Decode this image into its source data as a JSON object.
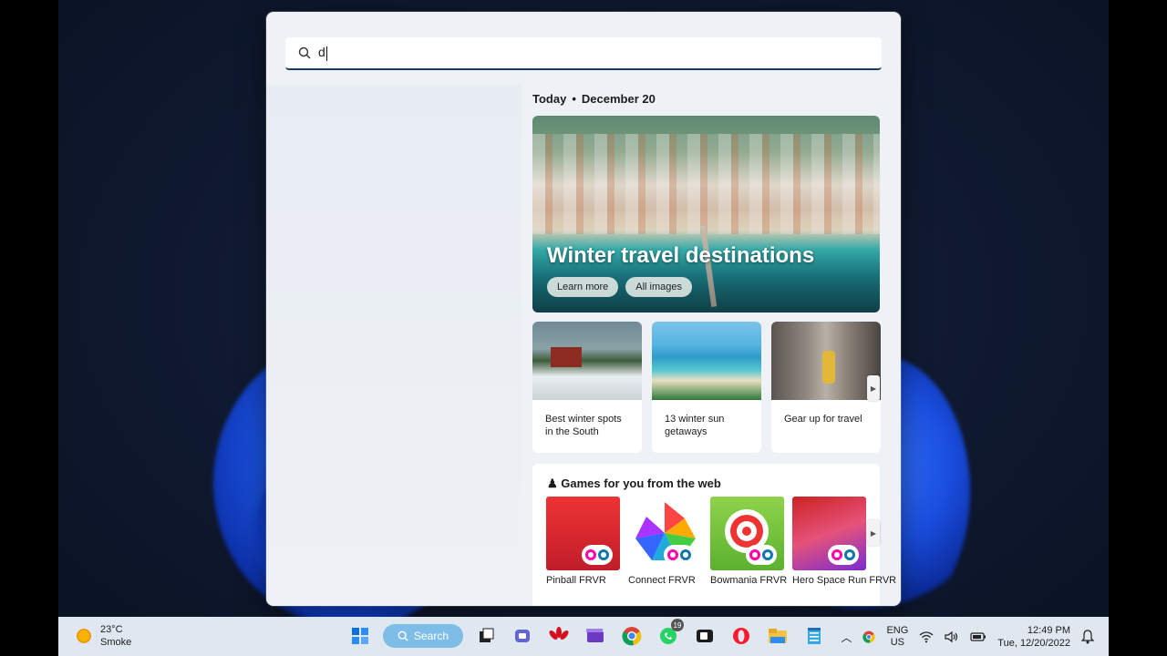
{
  "search": {
    "value": "d"
  },
  "today": {
    "label": "Today",
    "date": "December 20"
  },
  "hero": {
    "title": "Winter travel destinations",
    "learn_more": "Learn more",
    "all_images": "All images"
  },
  "cards": [
    {
      "caption": "Best winter spots in the South"
    },
    {
      "caption": "13 winter sun getaways"
    },
    {
      "caption": "Gear up for travel"
    }
  ],
  "games": {
    "heading": "Games for you from the web",
    "items": [
      {
        "label": "Pinball FRVR"
      },
      {
        "label": "Connect FRVR"
      },
      {
        "label": "Bowmania FRVR"
      },
      {
        "label": "Hero Space Run FRVR"
      }
    ]
  },
  "taskbar": {
    "weather_temp": "23°C",
    "weather_desc": "Smoke",
    "search_label": "Search",
    "whatsapp_badge": "19",
    "lang_top": "ENG",
    "lang_bottom": "US",
    "time": "12:49 PM",
    "date": "Tue, 12/20/2022"
  },
  "icons": [
    "search-icon",
    "start-icon",
    "task-view-icon",
    "teams-icon",
    "huawei-icon",
    "clipchamp-icon",
    "chrome-icon",
    "whatsapp-icon",
    "camera-icon",
    "opera-icon",
    "file-explorer-icon",
    "notepad-icon",
    "chevron-up-icon",
    "wifi-icon",
    "volume-icon",
    "battery-icon",
    "notification-icon"
  ]
}
